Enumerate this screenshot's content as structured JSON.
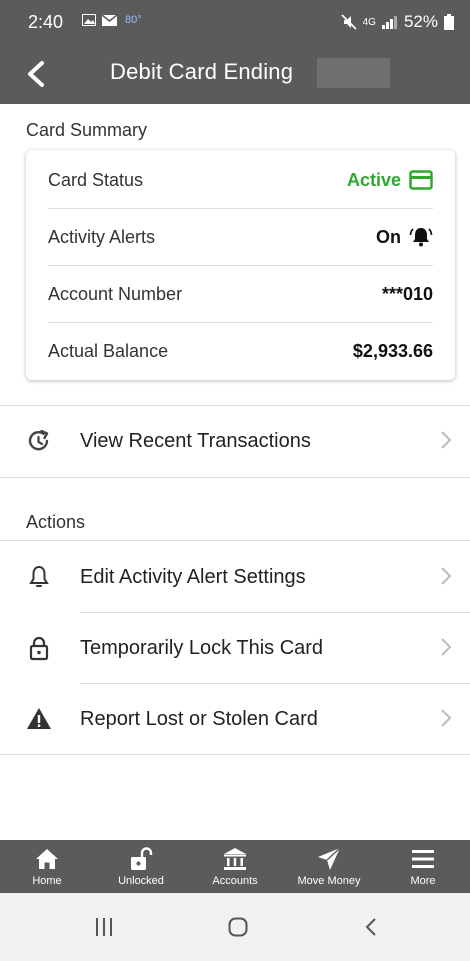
{
  "status_bar": {
    "time": "2:40",
    "temperature": "80°",
    "battery": "52%",
    "network": "4G"
  },
  "header": {
    "title": "Debit Card Ending"
  },
  "card_summary": {
    "heading": "Card Summary",
    "rows": [
      {
        "label": "Card Status",
        "value": "Active",
        "icon": "credit-card-icon",
        "color": "#2fa82f"
      },
      {
        "label": "Activity Alerts",
        "value": "On",
        "icon": "bell-ringing-icon"
      },
      {
        "label": "Account Number",
        "value": "***010"
      },
      {
        "label": "Actual Balance",
        "value": "$2,933.66"
      }
    ]
  },
  "recent": {
    "label": "View Recent Transactions",
    "icon": "history-icon"
  },
  "actions": {
    "heading": "Actions",
    "items": [
      {
        "label": "Edit Activity Alert Settings",
        "icon": "bell-icon"
      },
      {
        "label": "Temporarily Lock This Card",
        "icon": "lock-icon"
      },
      {
        "label": "Report Lost or Stolen Card",
        "icon": "warning-icon"
      }
    ]
  },
  "bottom_nav": [
    {
      "label": "Home",
      "icon": "home-icon"
    },
    {
      "label": "Unlocked",
      "icon": "unlock-icon"
    },
    {
      "label": "Accounts",
      "icon": "bank-icon"
    },
    {
      "label": "Move Money",
      "icon": "send-icon"
    },
    {
      "label": "More",
      "icon": "menu-icon"
    }
  ],
  "colors": {
    "header": "#5b5b5b",
    "active": "#2fa82f"
  }
}
